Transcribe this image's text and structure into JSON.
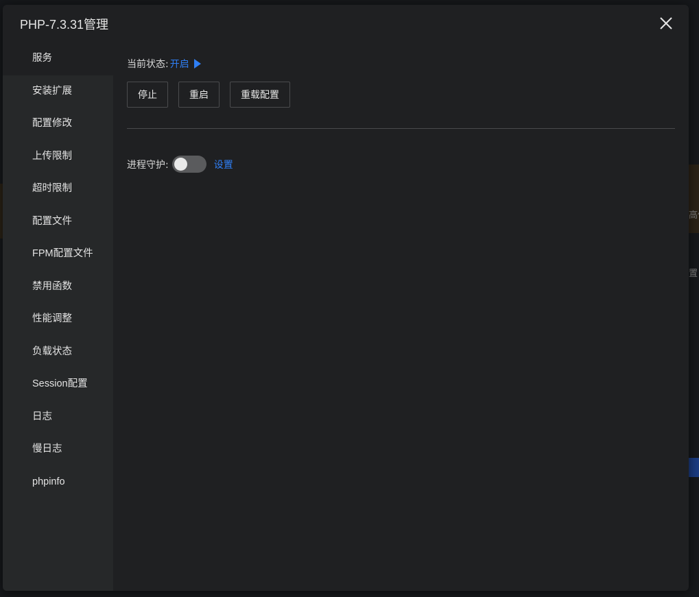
{
  "background": {
    "frag_right_1": "高俑",
    "frag_right_2": "置"
  },
  "dialog": {
    "title": "PHP-7.3.31管理",
    "close_icon": "close-icon"
  },
  "sidebar": {
    "items": [
      {
        "label": "服务",
        "active": true
      },
      {
        "label": "安装扩展"
      },
      {
        "label": "配置修改"
      },
      {
        "label": "上传限制"
      },
      {
        "label": "超时限制"
      },
      {
        "label": "配置文件"
      },
      {
        "label": "FPM配置文件"
      },
      {
        "label": "禁用函数"
      },
      {
        "label": "性能调整"
      },
      {
        "label": "负载状态"
      },
      {
        "label": "Session配置"
      },
      {
        "label": "日志"
      },
      {
        "label": "慢日志"
      },
      {
        "label": "phpinfo"
      }
    ]
  },
  "service": {
    "status_label": "当前状态:",
    "status_value": "开启",
    "status_icon": "play-icon",
    "buttons": {
      "stop": "停止",
      "restart": "重启",
      "reload": "重载配置"
    },
    "guard_label": "进程守护:",
    "guard_enabled": false,
    "guard_link": "设置"
  },
  "colors": {
    "accent": "#2f7ff5",
    "dialog_bg": "#1f2022",
    "sidebar_bg": "#262829"
  }
}
